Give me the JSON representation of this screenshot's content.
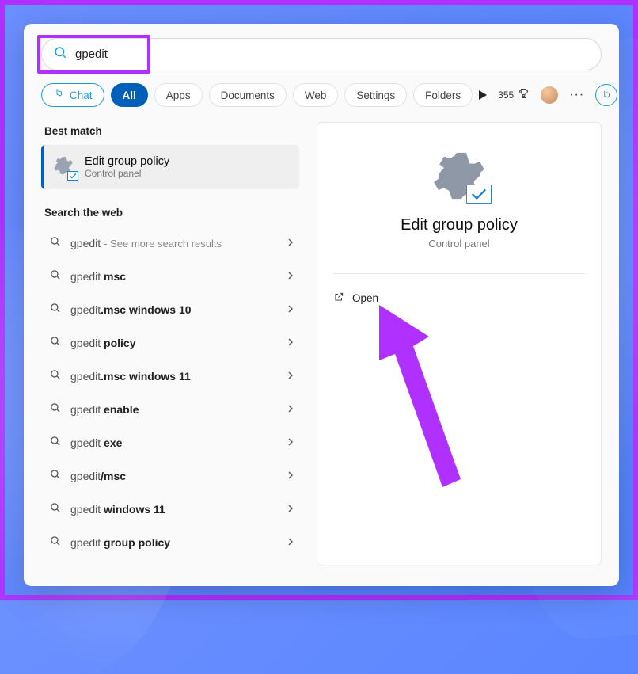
{
  "search": {
    "query": "gpedit"
  },
  "filters": {
    "chat": "Chat",
    "all": "All",
    "apps": "Apps",
    "documents": "Documents",
    "web": "Web",
    "settings": "Settings",
    "folders": "Folders"
  },
  "rewards": {
    "points": "355"
  },
  "left": {
    "best_match_heading": "Best match",
    "best_item": {
      "title": "Edit group policy",
      "subtitle": "Control panel"
    },
    "search_web_heading": "Search the web",
    "web_results": [
      {
        "prefix": "gpedit",
        "bold": "",
        "hint": "See more search results"
      },
      {
        "prefix": "gpedit ",
        "bold": "msc",
        "hint": ""
      },
      {
        "prefix": "gpedit",
        "bold": ".msc windows 10",
        "hint": ""
      },
      {
        "prefix": "gpedit ",
        "bold": "policy",
        "hint": ""
      },
      {
        "prefix": "gpedit",
        "bold": ".msc windows 11",
        "hint": ""
      },
      {
        "prefix": "gpedit ",
        "bold": "enable",
        "hint": ""
      },
      {
        "prefix": "gpedit ",
        "bold": "exe",
        "hint": ""
      },
      {
        "prefix": "gpedit",
        "bold": "/msc",
        "hint": ""
      },
      {
        "prefix": "gpedit ",
        "bold": "windows 11",
        "hint": ""
      },
      {
        "prefix": "gpedit ",
        "bold": "group policy",
        "hint": ""
      }
    ]
  },
  "preview": {
    "title": "Edit group policy",
    "subtitle": "Control panel",
    "open_label": "Open"
  }
}
